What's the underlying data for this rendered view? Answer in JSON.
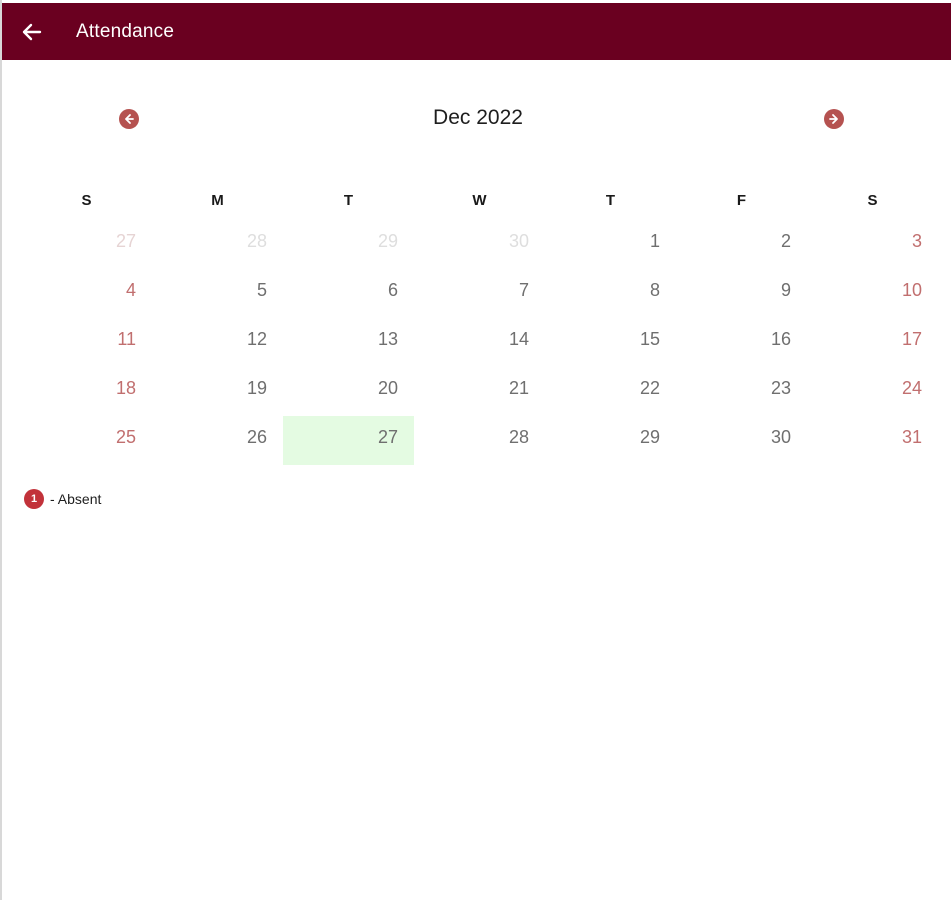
{
  "app": {
    "title": "Attendance",
    "theme_color": "#6a0020"
  },
  "toolbar": {
    "back_icon": "arrow-left-icon"
  },
  "calendar": {
    "month_label": "Dec 2022",
    "prev_icon": "chevron-left-circle-icon",
    "next_icon": "chevron-right-circle-icon",
    "weekdays": [
      "S",
      "M",
      "T",
      "W",
      "T",
      "F",
      "S"
    ],
    "weeks": [
      [
        {
          "label": "27",
          "other_month": true
        },
        {
          "label": "28",
          "other_month": true
        },
        {
          "label": "29",
          "other_month": true
        },
        {
          "label": "30",
          "other_month": true
        },
        {
          "label": "1"
        },
        {
          "label": "2"
        },
        {
          "label": "3"
        }
      ],
      [
        {
          "label": "4"
        },
        {
          "label": "5"
        },
        {
          "label": "6"
        },
        {
          "label": "7"
        },
        {
          "label": "8"
        },
        {
          "label": "9"
        },
        {
          "label": "10"
        }
      ],
      [
        {
          "label": "11"
        },
        {
          "label": "12"
        },
        {
          "label": "13"
        },
        {
          "label": "14"
        },
        {
          "label": "15"
        },
        {
          "label": "16"
        },
        {
          "label": "17"
        }
      ],
      [
        {
          "label": "18"
        },
        {
          "label": "19"
        },
        {
          "label": "20"
        },
        {
          "label": "21"
        },
        {
          "label": "22"
        },
        {
          "label": "23"
        },
        {
          "label": "24"
        }
      ],
      [
        {
          "label": "25"
        },
        {
          "label": "26"
        },
        {
          "label": "27",
          "today": true
        },
        {
          "label": "28"
        },
        {
          "label": "29"
        },
        {
          "label": "30"
        },
        {
          "label": "31"
        }
      ]
    ],
    "today_highlight_color": "#e4fbe2",
    "weekend_color": "#c16f6f"
  },
  "legend": {
    "badge": "1",
    "label": "- Absent",
    "badge_color": "#c2323a"
  }
}
